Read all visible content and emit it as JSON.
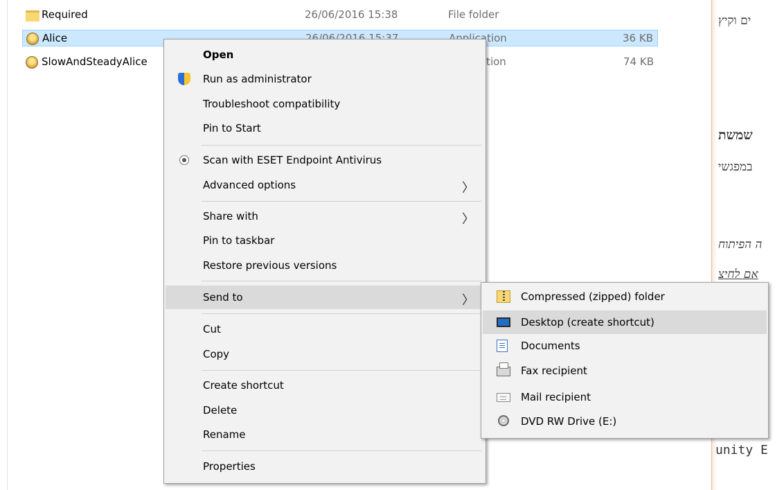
{
  "files": [
    {
      "name": "Required",
      "date": "26/06/2016 15:38",
      "type": "File folder",
      "size": "",
      "icon": "folder-icon",
      "selected": false
    },
    {
      "name": "Alice",
      "date": "26/06/2016 15:37",
      "type": "Application",
      "size": "36 KB",
      "icon": "alice-app-icon",
      "selected": true
    },
    {
      "name": "SlowAndSteadyAlice",
      "date": "",
      "type": "Application",
      "size": "74 KB",
      "icon": "alice-app-icon",
      "selected": false
    }
  ],
  "context_menu": {
    "open": "Open",
    "run_as_admin": "Run as administrator",
    "troubleshoot": "Troubleshoot compatibility",
    "pin_start": "Pin to Start",
    "scan_eset": "Scan with ESET Endpoint Antivirus",
    "advanced_options": "Advanced options",
    "share_with": "Share with",
    "pin_taskbar": "Pin to taskbar",
    "restore_versions": "Restore previous versions",
    "send_to": "Send to",
    "cut": "Cut",
    "copy": "Copy",
    "create_shortcut": "Create shortcut",
    "delete": "Delete",
    "rename": "Rename",
    "properties": "Properties",
    "submenu_arrow": "〉"
  },
  "send_to_menu": {
    "items": [
      {
        "label": "Compressed (zipped) folder",
        "icon": "zip-folder-icon"
      },
      {
        "label": "Desktop (create shortcut)",
        "icon": "desktop-icon",
        "highlighted": true
      },
      {
        "label": "Documents",
        "icon": "documents-icon"
      },
      {
        "label": "Fax recipient",
        "icon": "fax-icon"
      },
      {
        "label": "Mail recipient",
        "icon": "mail-icon"
      },
      {
        "label": "DVD RW Drive (E:)",
        "icon": "dvd-drive-icon"
      }
    ]
  },
  "background_doc": {
    "line1": "ים וקיץ",
    "line2": "שמשת",
    "line3": "במפגשי",
    "line4": "ה הפיתוח",
    "line5": "אם לחיצ",
    "line6": "unity E"
  },
  "colors": {
    "selection": "#cce8ff",
    "menu_bg": "#f2f2f2",
    "menu_highlight": "#dadada"
  }
}
